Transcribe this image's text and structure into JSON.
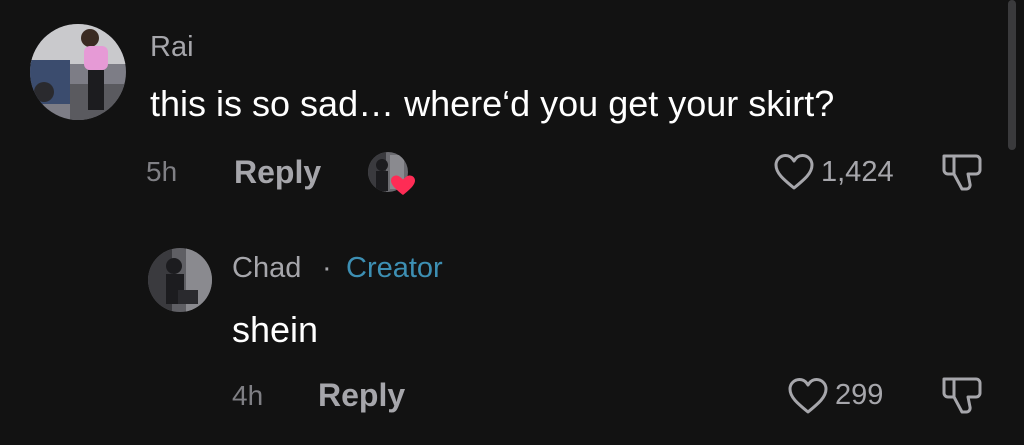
{
  "comment": {
    "username": "Rai",
    "text": "this is so sad… where‘d you get your skirt?",
    "time": "5h",
    "reply_label": "Reply",
    "like_count": "1,424",
    "icons": {
      "liked_by_creator": "creator-heart-icon",
      "like": "heart-outline-icon",
      "dislike": "thumbs-down-icon"
    }
  },
  "reply": {
    "username": "Chad",
    "separator": "·",
    "creator_badge": "Creator",
    "text": "shein",
    "time": "4h",
    "reply_label": "Reply",
    "like_count": "299",
    "icons": {
      "like": "heart-outline-icon",
      "dislike": "thumbs-down-icon"
    }
  },
  "colors": {
    "background": "#121212",
    "creator_accent": "#3d8fb3",
    "liked_heart": "#fe2c55"
  }
}
